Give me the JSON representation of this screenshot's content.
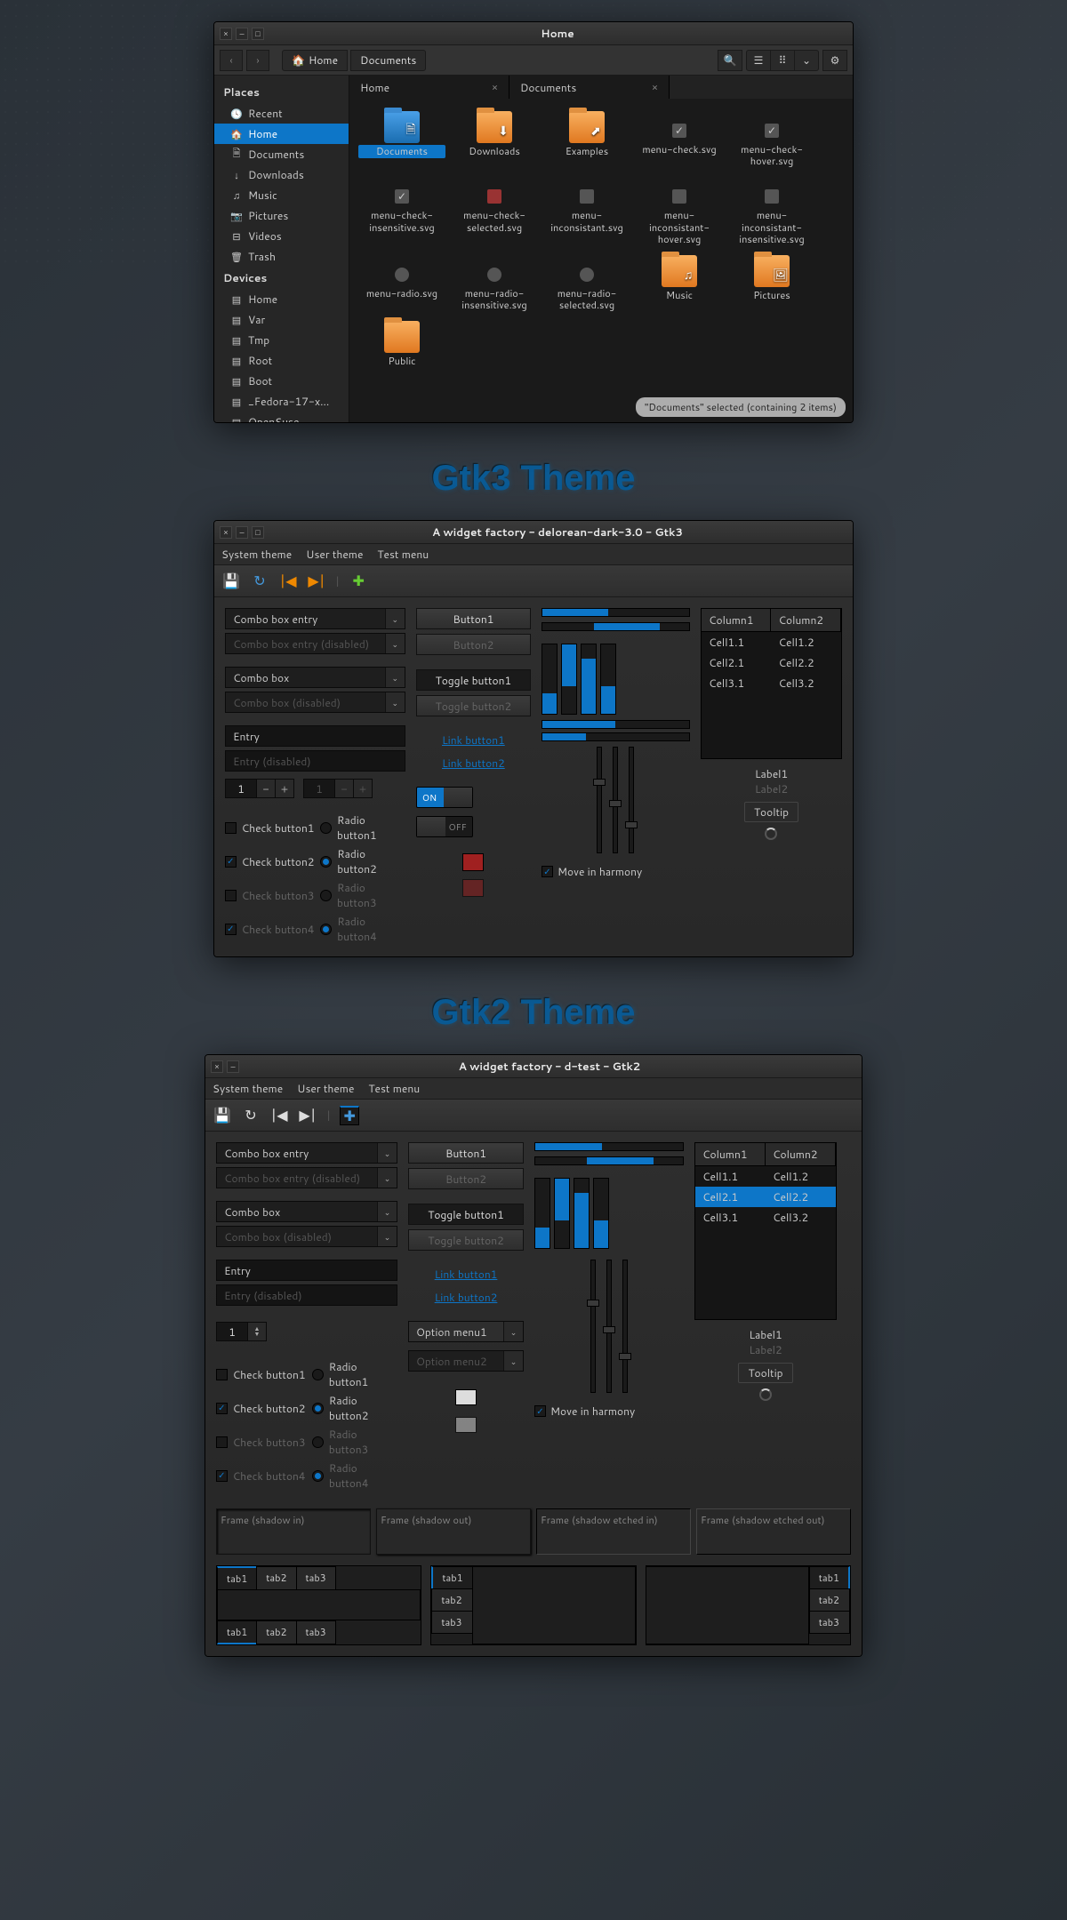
{
  "fm": {
    "title": "Home",
    "path": [
      "Home",
      "Documents"
    ],
    "sidebar": {
      "places_head": "Places",
      "places": [
        {
          "icon": "🕓",
          "name": "Recent"
        },
        {
          "icon": "🏠",
          "name": "Home",
          "sel": true
        },
        {
          "icon": "🗎",
          "name": "Documents"
        },
        {
          "icon": "↓",
          "name": "Downloads"
        },
        {
          "icon": "♫",
          "name": "Music"
        },
        {
          "icon": "📷",
          "name": "Pictures"
        },
        {
          "icon": "⊟",
          "name": "Videos"
        },
        {
          "icon": "🗑",
          "name": "Trash"
        }
      ],
      "devices_head": "Devices",
      "devices": [
        {
          "icon": "▤",
          "name": "Home"
        },
        {
          "icon": "▤",
          "name": "Var"
        },
        {
          "icon": "▤",
          "name": "Tmp"
        },
        {
          "icon": "▤",
          "name": "Root"
        },
        {
          "icon": "▤",
          "name": "Boot"
        },
        {
          "icon": "▤",
          "name": "_Fedora-17-x..."
        },
        {
          "icon": "▤",
          "name": "OpenSuse"
        }
      ]
    },
    "tabs": [
      {
        "name": "Home"
      },
      {
        "name": "Documents"
      }
    ],
    "files": [
      {
        "type": "folder",
        "color": "blue",
        "name": "Documents",
        "sel": true,
        "overlay": "🗎"
      },
      {
        "type": "folder",
        "color": "orange",
        "name": "Downloads",
        "overlay": "⬇"
      },
      {
        "type": "folder",
        "color": "orange",
        "name": "Examples",
        "overlay": "⬈"
      },
      {
        "type": "svg",
        "sub": "check",
        "name": "menu-check.svg"
      },
      {
        "type": "svg",
        "sub": "check",
        "name": "menu-check-hover.svg"
      },
      {
        "type": "svg",
        "sub": "check",
        "name": "menu-check-insensitive.svg"
      },
      {
        "type": "svg",
        "sub": "red",
        "name": "menu-check-selected.svg"
      },
      {
        "type": "svg",
        "sub": "",
        "name": "menu-inconsistant.svg"
      },
      {
        "type": "svg",
        "sub": "",
        "name": "menu-inconsistant-hover.svg"
      },
      {
        "type": "svg",
        "sub": "",
        "name": "menu-inconsistant-insensitive.svg"
      },
      {
        "type": "svg",
        "sub": "radio",
        "name": "menu-radio.svg"
      },
      {
        "type": "svg",
        "sub": "radio",
        "name": "menu-radio-insensitive.svg"
      },
      {
        "type": "svg",
        "sub": "radio",
        "name": "menu-radio-selected.svg"
      },
      {
        "type": "folder",
        "color": "orange",
        "name": "Music",
        "overlay": "♫"
      },
      {
        "type": "folder",
        "color": "orange",
        "name": "Pictures",
        "overlay": "🖼"
      },
      {
        "type": "folder",
        "color": "orange",
        "name": "Public",
        "overlay": ""
      }
    ],
    "status": "\"Documents\" selected (containing 2 items)"
  },
  "section_gtk3": "Gtk3 Theme",
  "section_gtk2": "Gtk2 Theme",
  "wf3": {
    "title": "A widget factory - delorean-dark-3.0 - Gtk3",
    "menu": [
      "System theme",
      "User theme",
      "Test menu"
    ],
    "combo_entry": "Combo box entry",
    "combo_entry_dis": "Combo box entry (disabled)",
    "combo": "Combo box",
    "combo_dis": "Combo box (disabled)",
    "entry": "Entry",
    "entry_dis": "Entry (disabled)",
    "spin_val": "1",
    "checks": [
      {
        "label": "Check button1",
        "on": false,
        "dis": false
      },
      {
        "label": "Check button2",
        "on": true,
        "dis": false
      },
      {
        "label": "Check button3",
        "on": false,
        "dis": true
      },
      {
        "label": "Check button4",
        "on": true,
        "dis": true
      }
    ],
    "radios": [
      {
        "label": "Radio button1",
        "on": false,
        "dis": false
      },
      {
        "label": "Radio button2",
        "on": true,
        "dis": false
      },
      {
        "label": "Radio button3",
        "on": false,
        "dis": true
      },
      {
        "label": "Radio button4",
        "on": true,
        "dis": true
      }
    ],
    "btn1": "Button1",
    "btn2": "Button2",
    "toggle1": "Toggle button1",
    "toggle2": "Toggle button2",
    "link1": "Link button1",
    "link2": "Link button2",
    "switch_on": "ON",
    "switch_off": "OFF",
    "harmony": "Move in harmony",
    "table": {
      "cols": [
        "Column1",
        "Column2"
      ],
      "rows": [
        [
          "Cell1.1",
          "Cell1.2"
        ],
        [
          "Cell2.1",
          "Cell2.2"
        ],
        [
          "Cell3.1",
          "Cell3.2"
        ]
      ],
      "sel": -1
    },
    "label1": "Label1",
    "label2": "Label2",
    "tooltip": "Tooltip"
  },
  "wf2": {
    "title": "A widget factory - d-test - Gtk2",
    "menu": [
      "System theme",
      "User theme",
      "Test menu"
    ],
    "combo_entry": "Combo box entry",
    "combo_entry_dis": "Combo box entry (disabled)",
    "combo": "Combo box",
    "combo_dis": "Combo box (disabled)",
    "entry": "Entry",
    "entry_dis": "Entry (disabled)",
    "spin_val": "1",
    "checks": [
      {
        "label": "Check button1",
        "on": false,
        "dis": false
      },
      {
        "label": "Check button2",
        "on": true,
        "dis": false
      },
      {
        "label": "Check button3",
        "on": false,
        "dis": true
      },
      {
        "label": "Check button4",
        "on": true,
        "dis": true
      }
    ],
    "radios": [
      {
        "label": "Radio button1",
        "on": false,
        "dis": false
      },
      {
        "label": "Radio button2",
        "on": true,
        "dis": false
      },
      {
        "label": "Radio button3",
        "on": false,
        "dis": true
      },
      {
        "label": "Radio button4",
        "on": true,
        "dis": true
      }
    ],
    "btn1": "Button1",
    "btn2": "Button2",
    "toggle1": "Toggle button1",
    "toggle2": "Toggle button2",
    "link1": "Link button1",
    "link2": "Link button2",
    "opt1": "Option menu1",
    "opt2": "Option menu2",
    "harmony": "Move in harmony",
    "table": {
      "cols": [
        "Column1",
        "Column2"
      ],
      "rows": [
        [
          "Cell1.1",
          "Cell1.2"
        ],
        [
          "Cell2.1",
          "Cell2.2"
        ],
        [
          "Cell3.1",
          "Cell3.2"
        ]
      ],
      "sel": 1
    },
    "label1": "Label1",
    "label2": "Label2",
    "tooltip": "Tooltip",
    "frames": [
      "Frame (shadow in)",
      "Frame (shadow out)",
      "Frame (shadow etched in)",
      "Frame (shadow etched out)"
    ],
    "tabs": [
      "tab1",
      "tab2",
      "tab3"
    ]
  }
}
